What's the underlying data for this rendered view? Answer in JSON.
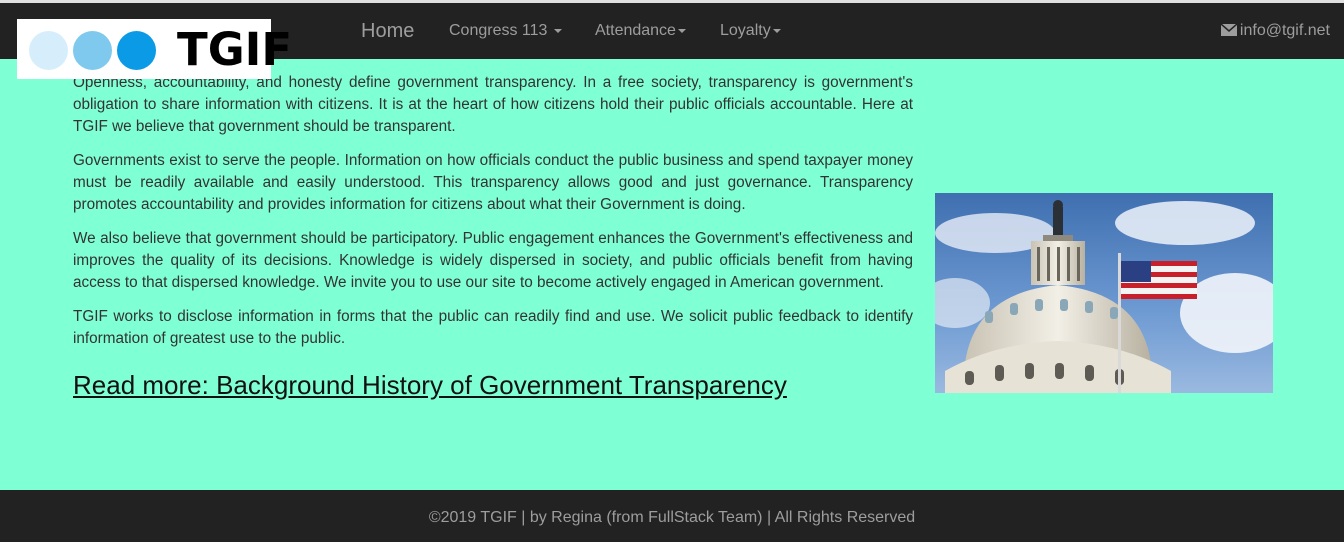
{
  "brand": {
    "logo_text": "TGIF"
  },
  "nav": {
    "home": "Home",
    "congress": "Congress 113",
    "attendance": "Attendance",
    "loyalty": "Loyalty",
    "email": "info@tgif.net"
  },
  "main": {
    "paragraphs": [
      "Openness, accountability, and honesty define government transparency. In a free society, transparency is government's obligation to share information with citizens. It is at the heart of how citizens hold their public officials accountable. Here at TGIF we believe that government should be transparent.",
      "Governments exist to serve the people. Information on how officials conduct the public business and spend taxpayer money must be readily available and easily understood. This transparency allows good and just governance. Transparency promotes accountability and provides information for citizens about what their Government is doing.",
      "We also believe that government should be participatory. Public engagement enhances the Government's effectiveness and improves the quality of its decisions. Knowledge is widely dispersed in society, and public officials benefit from having access to that dispersed knowledge. We invite you to use our site to become actively engaged in American government.",
      "TGIF works to disclose information in forms that the public can readily find and use. We solicit public feedback to identify information of greatest use to the public."
    ],
    "read_more": "Read more: Background History of Government Transparency"
  },
  "footer": {
    "text": "©2019 TGIF | by Regina (from FullStack Team) | All Rights Reserved"
  },
  "colors": {
    "page_background": "#7fffd4",
    "navbar": "#222222",
    "nav_text": "#9d9d9d",
    "logo_circles": [
      "#d6eefb",
      "#7fc8ee",
      "#0a9ae6"
    ]
  },
  "icons": {
    "email": "envelope-icon",
    "dropdown": "caret-down-icon"
  }
}
